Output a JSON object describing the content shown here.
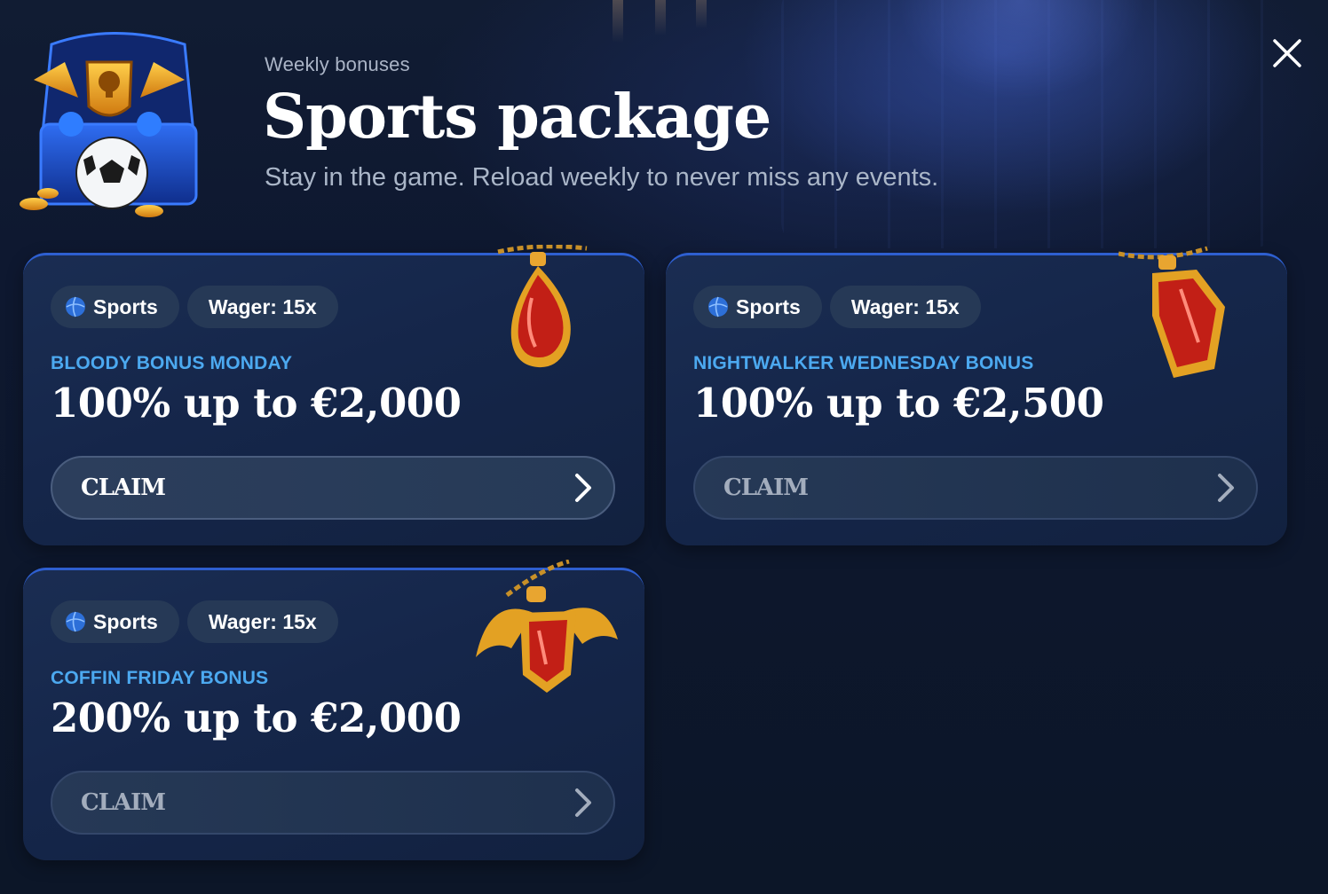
{
  "header": {
    "eyebrow": "Weekly bonuses",
    "title": "Sports package",
    "subtitle": "Stay in the game. Reload weekly to never miss any events."
  },
  "icons": {
    "close": "close-icon",
    "chest": "treasure-chest-icon",
    "sport": "sports-ball-icon",
    "chevron": "chevron-right-icon"
  },
  "colors": {
    "accent_blue": "#4ca9f0",
    "card_bg": "#15264a",
    "card_border": "#2e5fd0",
    "tag_bg": "#263956"
  },
  "cards": [
    {
      "tag_sport": "Sports",
      "tag_wager": "Wager: 15x",
      "name": "BLOODY BONUS MONDAY",
      "amount": "100% up to €2,000",
      "claim_label": "CLAIM",
      "claim_state": "active",
      "gem": "ruby-drop-pendant-icon"
    },
    {
      "tag_sport": "Sports",
      "tag_wager": "Wager: 15x",
      "name": "NIGHTWALKER WEDNESDAY BONUS",
      "amount": "100% up to €2,500",
      "claim_label": "CLAIM",
      "claim_state": "dim",
      "gem": "coffin-pendant-icon"
    },
    {
      "tag_sport": "Sports",
      "tag_wager": "Wager: 15x",
      "name": "COFFIN FRIDAY BONUS",
      "amount": "200% up to €2,000",
      "claim_label": "CLAIM",
      "claim_state": "dim",
      "gem": "bat-wing-pendant-icon"
    }
  ]
}
